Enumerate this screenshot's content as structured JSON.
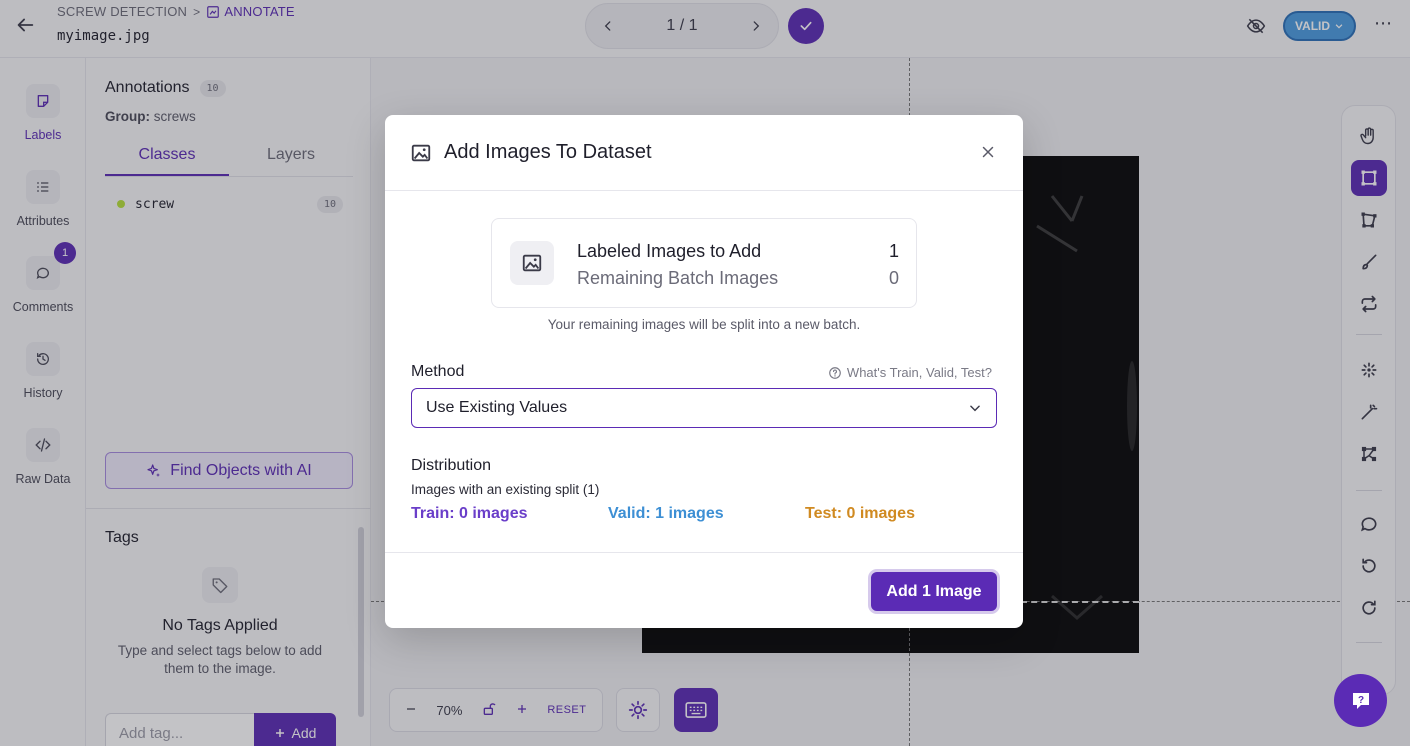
{
  "header": {
    "breadcrumb_project": "SCREW DETECTION",
    "breadcrumb_sep": ">",
    "breadcrumb_current": "ANNOTATE",
    "filename": "myimage.jpg",
    "pager_text": "1 / 1",
    "status_label": "VALID"
  },
  "rail": {
    "items": [
      {
        "label": "Labels",
        "icon": "sticky-note-icon"
      },
      {
        "label": "Attributes",
        "icon": "list-icon"
      },
      {
        "label": "Comments",
        "icon": "comment-icon",
        "badge": "1"
      },
      {
        "label": "History",
        "icon": "history-icon"
      },
      {
        "label": "Raw Data",
        "icon": "code-icon"
      }
    ]
  },
  "panel": {
    "title": "Annotations",
    "count": "10",
    "group_label": "Group:",
    "group_value": "screws",
    "tabs": [
      "Classes",
      "Layers"
    ],
    "classes": [
      {
        "name": "screw",
        "count": "10",
        "color": "#b6e03a"
      }
    ],
    "find_button": "Find Objects with AI",
    "tags_title": "Tags",
    "no_tags": "No Tags Applied",
    "tags_desc": "Type and select tags below to add them to the image.",
    "tag_placeholder": "Add tag...",
    "tag_add": "Add"
  },
  "canvas": {
    "zoom": "70%",
    "reset": "RESET"
  },
  "modal": {
    "title": "Add Images To Dataset",
    "labeled_label": "Labeled Images to Add",
    "labeled_value": "1",
    "remaining_label": "Remaining Batch Images",
    "remaining_value": "0",
    "split_note": "Your remaining images will be split into a new batch.",
    "method_label": "Method",
    "help_link": "What's Train, Valid, Test?",
    "method_value": "Use Existing Values",
    "distribution_label": "Distribution",
    "distribution_sub": "Images with an existing split (1)",
    "train": "Train: 0 images",
    "valid": "Valid: 1 images",
    "test": "Test: 0 images",
    "submit": "Add 1 Image"
  },
  "colors": {
    "accent": "#5b2bb5",
    "valid": "#3d8fd4",
    "test": "#d08a21",
    "train": "#6a3ec9"
  }
}
